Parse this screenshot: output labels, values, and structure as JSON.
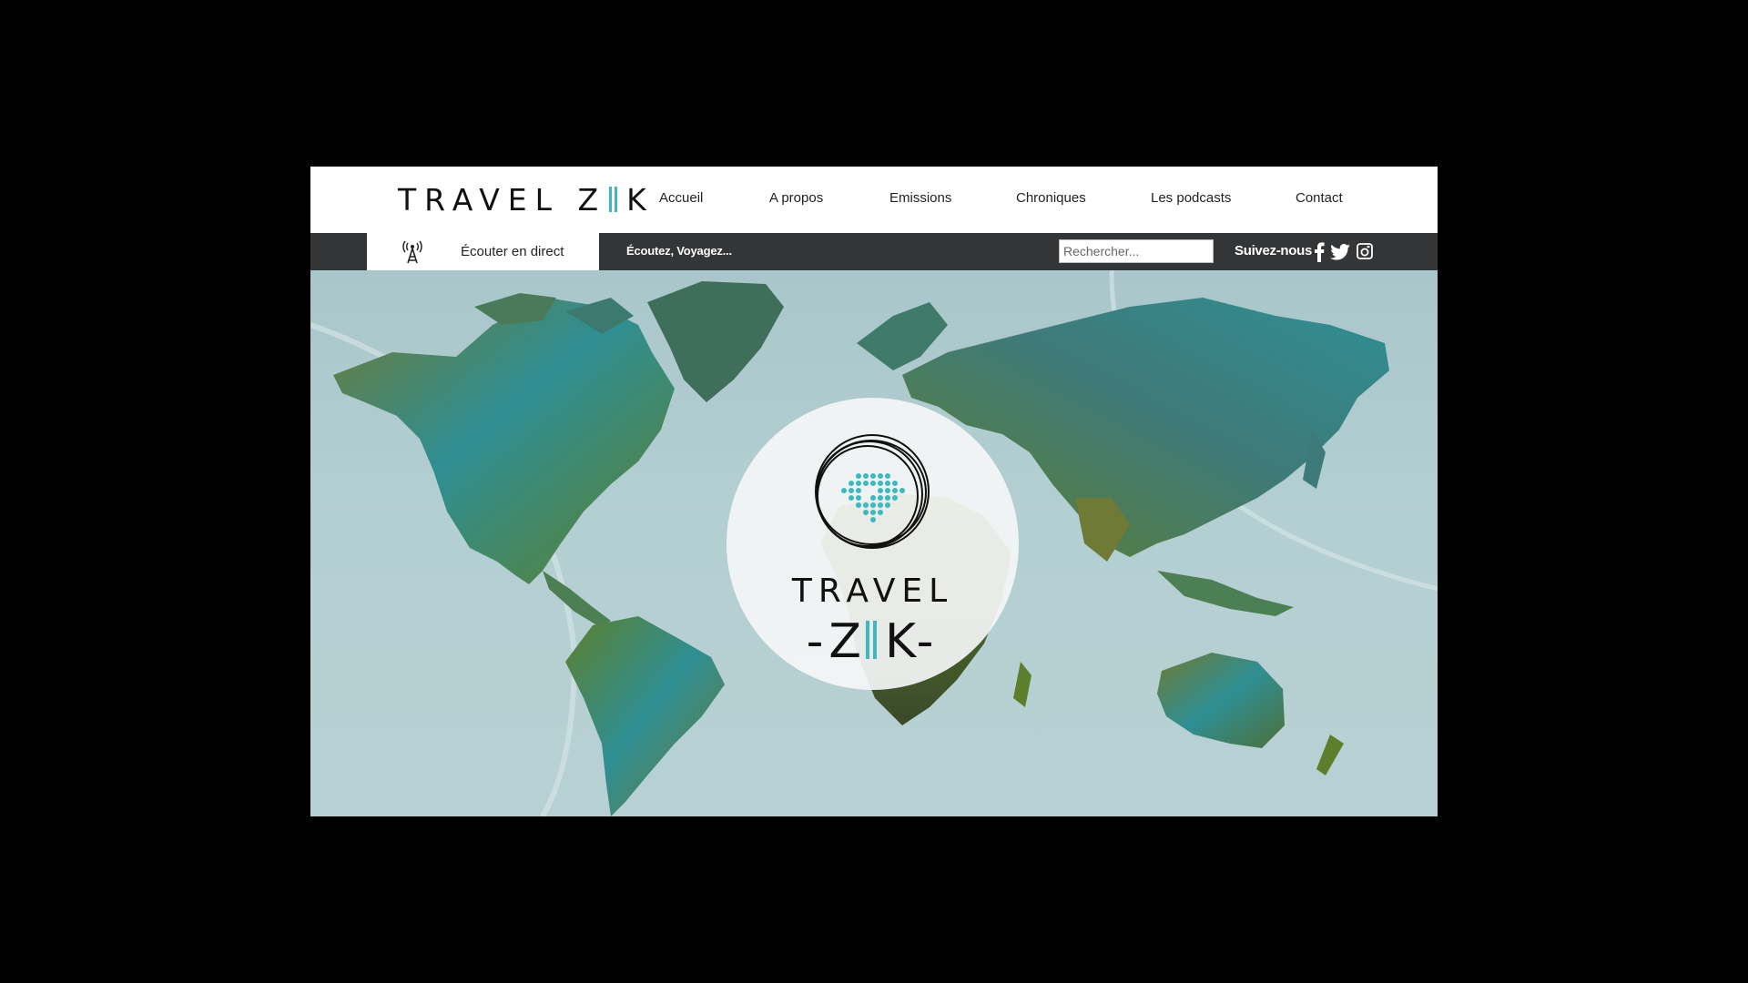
{
  "brand": {
    "logo_left": "TRAVEL Z",
    "logo_right": "K",
    "accent_color": "#3fb7c0"
  },
  "nav": {
    "items": [
      {
        "label": "Accueil"
      },
      {
        "label": "A propos"
      },
      {
        "label": "Emissions"
      },
      {
        "label": "Chroniques"
      },
      {
        "label": "Les podcasts"
      },
      {
        "label": "Contact"
      }
    ]
  },
  "subbar": {
    "live_label": "Écouter en direct",
    "live_icon": "radio-tower-icon",
    "tagline": "Écoutez, Voyagez...",
    "search_placeholder": "Rechercher...",
    "follow_label": "Suivez-nous",
    "social_icons": [
      "facebook-icon",
      "twitter-icon",
      "instagram-icon"
    ],
    "bar_color": "#333536"
  },
  "hero": {
    "center_title": "TRAVEL",
    "center_zik_left": "-Z",
    "center_zik_right": "K-",
    "map_colors": [
      "#3f7a7a",
      "#5d7f2c",
      "#2f8f93",
      "#6e7a35"
    ],
    "ocean_color": "#b4cfd2"
  }
}
